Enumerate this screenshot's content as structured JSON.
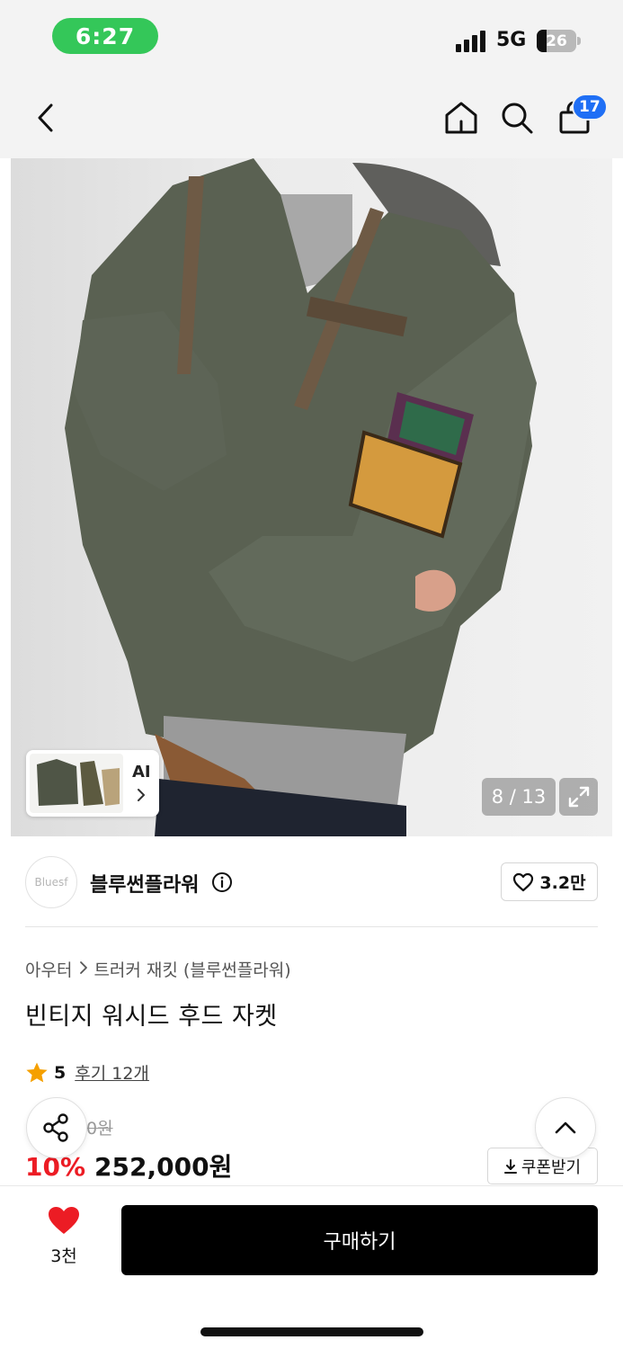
{
  "status_bar": {
    "time": "6:27",
    "network": "5G",
    "battery": "26",
    "battery_level": 0.26,
    "time_pill_color": "#34c759"
  },
  "nav": {
    "back_icon": "chevron-left-icon",
    "home_icon": "home-icon",
    "search_icon": "search-icon",
    "cart_icon": "shopping-bag-icon",
    "cart_count": "17",
    "badge_color": "#1f6ff5"
  },
  "gallery": {
    "ai_label": "AI",
    "counter": "8 / 13",
    "expand_icon": "expand-icon"
  },
  "brand": {
    "logo_text": "Bluesf",
    "name": "블루썬플라워",
    "like_count": "3.2만"
  },
  "product": {
    "breadcrumb": [
      "아우터",
      "트러커 재킷 (블루썬플라워)"
    ],
    "title": "빈티지 워시드 후드 자켓",
    "rating": "5",
    "rating_color": "#f5a000",
    "review_text": "후기 12개",
    "original_price": "0원",
    "discount": "10%",
    "discount_color": "#ec1c24",
    "sale_price": "252,000원",
    "coupon_label": "쿠폰받기"
  },
  "bottom": {
    "wish_count": "3천",
    "wish_color": "#ec1c24",
    "buy_label": "구매하기"
  }
}
